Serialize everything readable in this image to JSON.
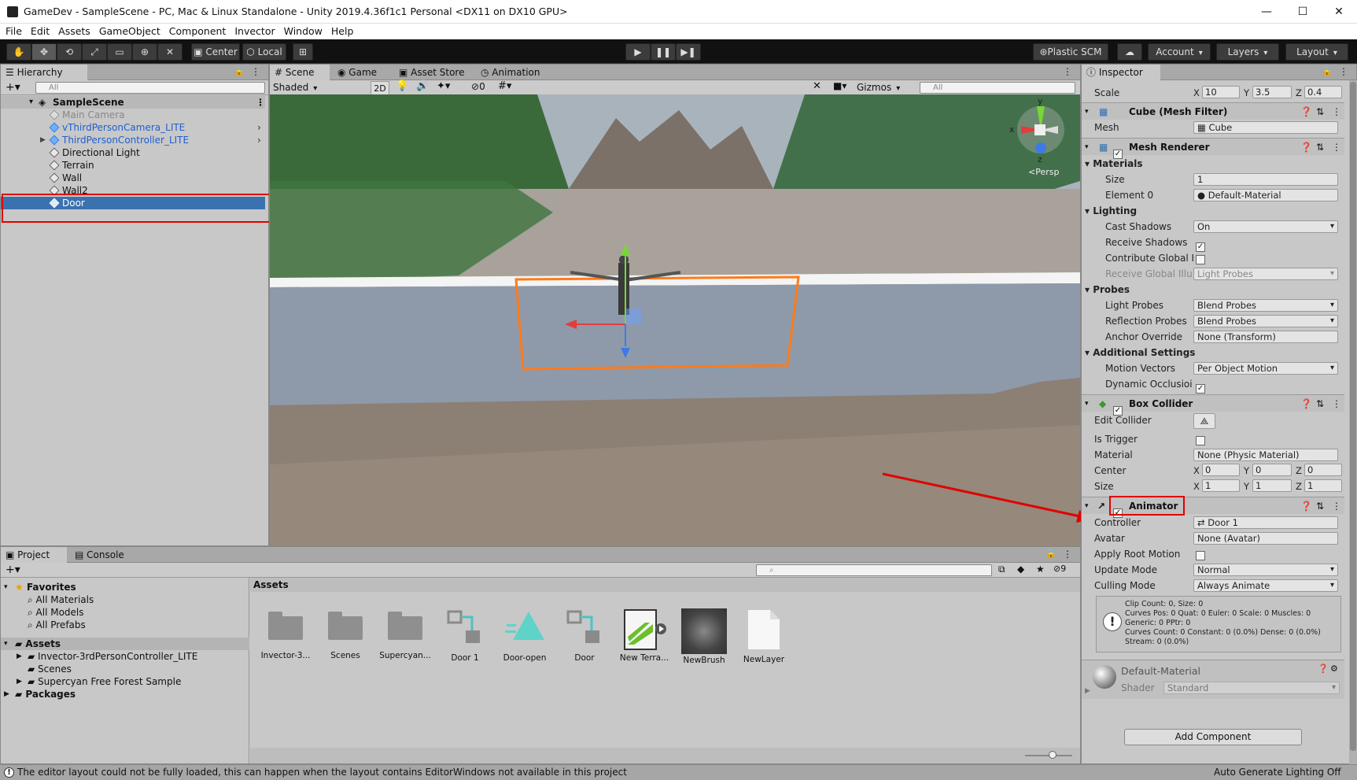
{
  "window": {
    "title": "GameDev - SampleScene - PC, Mac & Linux Standalone - Unity 2019.4.36f1c1 Personal <DX11 on DX10 GPU>",
    "minimize": "—",
    "maximize": "☐",
    "close": "✕"
  },
  "menu": [
    "File",
    "Edit",
    "Assets",
    "GameObject",
    "Component",
    "Invector",
    "Window",
    "Help"
  ],
  "toolbar": {
    "pivot": "Center",
    "space": "Local",
    "plastic": "Plastic SCM",
    "account": "Account",
    "layers": "Layers",
    "layout": "Layout"
  },
  "hierarchy": {
    "tab": "Hierarchy",
    "search_placeholder": "All",
    "scene": "SampleScene",
    "items": [
      {
        "label": "Main Camera",
        "style": "disabled"
      },
      {
        "label": "vThirdPersonCamera_LITE",
        "style": "prefab"
      },
      {
        "label": "ThirdPersonController_LITE",
        "style": "prefab"
      },
      {
        "label": "Directional Light",
        "style": "normal"
      },
      {
        "label": "Terrain",
        "style": "normal"
      },
      {
        "label": "Wall",
        "style": "normal"
      },
      {
        "label": "Wall2",
        "style": "normal"
      },
      {
        "label": "Door",
        "style": "selected"
      }
    ]
  },
  "scene": {
    "tabs": [
      "Scene",
      "Game",
      "Asset Store",
      "Animation"
    ],
    "shading": "Shaded",
    "mode2d": "2D",
    "hidden_count": "0",
    "gizmos": "Gizmos",
    "search_placeholder": "All",
    "persp": "Persp",
    "axis_x": "x",
    "axis_y": "y",
    "axis_z": "z"
  },
  "inspector": {
    "tab": "Inspector",
    "scale": {
      "label": "Scale",
      "x": "10",
      "y": "3.5",
      "z": "0.4"
    },
    "mesh_filter": {
      "title": "Cube (Mesh Filter)",
      "mesh_label": "Mesh",
      "mesh_value": "Cube"
    },
    "mesh_renderer": {
      "title": "Mesh Renderer",
      "materials": "Materials",
      "size_label": "Size",
      "size_value": "1",
      "element0_label": "Element 0",
      "element0_value": "Default-Material",
      "lighting": "Lighting",
      "cast_shadows_label": "Cast Shadows",
      "cast_shadows_value": "On",
      "receive_shadows_label": "Receive Shadows",
      "contribute_gi_label": "Contribute Global I",
      "receive_gi_label": "Receive Global Illu",
      "receive_gi_value": "Light Probes",
      "probes": "Probes",
      "light_probes_label": "Light Probes",
      "light_probes_value": "Blend Probes",
      "reflection_probes_label": "Reflection Probes",
      "reflection_probes_value": "Blend Probes",
      "anchor_label": "Anchor Override",
      "anchor_value": "None (Transform)",
      "additional": "Additional Settings",
      "motion_label": "Motion Vectors",
      "motion_value": "Per Object Motion",
      "dynamic_label": "Dynamic Occlusioi"
    },
    "box_collider": {
      "title": "Box Collider",
      "edit_label": "Edit Collider",
      "trigger_label": "Is Trigger",
      "material_label": "Material",
      "material_value": "None (Physic Material)",
      "center_label": "Center",
      "cx": "0",
      "cy": "0",
      "cz": "0",
      "size_label": "Size",
      "sx": "1",
      "sy": "1",
      "sz": "1"
    },
    "animator": {
      "title": "Animator",
      "controller_label": "Controller",
      "controller_value": "Door 1",
      "avatar_label": "Avatar",
      "avatar_value": "None (Avatar)",
      "root_motion_label": "Apply Root Motion",
      "update_label": "Update Mode",
      "update_value": "Normal",
      "culling_label": "Culling Mode",
      "culling_value": "Always Animate",
      "info": [
        "Clip Count: 0, Size: 0",
        "Curves Pos: 0 Quat: 0 Euler: 0 Scale: 0 Muscles: 0",
        "Generic: 0 PPtr: 0",
        "Curves Count: 0 Constant: 0 (0.0%) Dense: 0 (0.0%)",
        "Stream: 0 (0.0%)"
      ]
    },
    "material": {
      "name": "Default-Material",
      "shader_label": "Shader",
      "shader_value": "Standard"
    },
    "add_component": "Add Component"
  },
  "project": {
    "tabs": [
      "Project",
      "Console"
    ],
    "hidden_count": "9",
    "favorites": "Favorites",
    "fav_items": [
      "All Materials",
      "All Models",
      "All Prefabs"
    ],
    "assets_root": "Assets",
    "asset_folders": [
      "Invector-3rdPersonController_LITE",
      "Scenes",
      "Supercyan Free Forest Sample"
    ],
    "packages": "Packages",
    "breadcrumb": "Assets",
    "grid": [
      "Invector-3...",
      "Scenes",
      "Supercyan...",
      "Door 1",
      "Door-open",
      "Door",
      "New Terra...",
      "NewBrush",
      "NewLayer"
    ]
  },
  "status": {
    "message": "The editor layout could not be fully loaded, this can happen when the layout contains EditorWindows not available in this project",
    "right": "Auto Generate Lighting Off"
  }
}
